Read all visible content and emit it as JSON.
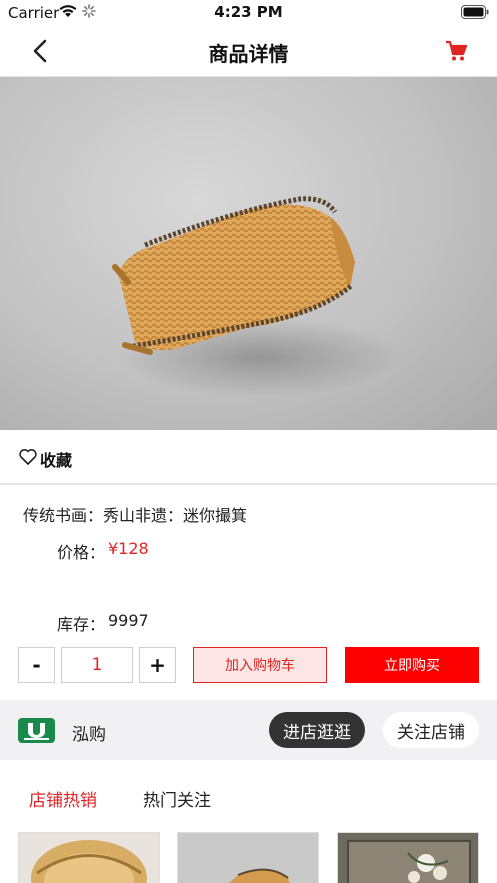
{
  "status_bar": {
    "carrier": "Carrier",
    "time": "4:23 PM"
  },
  "nav": {
    "title": "商品详情"
  },
  "favorite": {
    "label": "收藏"
  },
  "product": {
    "name": "传统书画：秀山非遗：迷你撮箕",
    "price_label": "价格：",
    "price": "¥128",
    "stock_label": "库存：",
    "stock": "9997"
  },
  "quantity": {
    "minus": "-",
    "value": "1",
    "plus": "+"
  },
  "actions": {
    "add_to_cart": "加入购物车",
    "buy_now": "立即购买"
  },
  "store": {
    "name": "泓购",
    "enter": "进店逛逛",
    "follow": "关注店铺"
  },
  "tabs": [
    {
      "label": "店铺热销",
      "active": true
    },
    {
      "label": "热门关注",
      "active": false
    }
  ],
  "colors": {
    "accent": "#e02424",
    "buy": "#ff0000",
    "logo": "#1a8a4a"
  },
  "icons": {
    "back": "chevron-left-icon",
    "cart": "shopping-cart-icon",
    "favorite": "heart-icon"
  }
}
